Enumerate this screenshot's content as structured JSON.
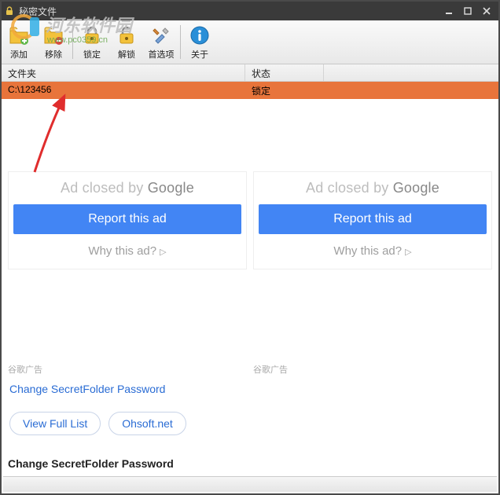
{
  "window": {
    "title": "秘密文件",
    "minimize": "—",
    "maximize": "□",
    "close": "×"
  },
  "toolbar": {
    "add": "添加",
    "remove": "移除",
    "lock": "锁定",
    "unlock": "解锁",
    "prefs": "首选项",
    "about": "关于"
  },
  "columns": {
    "folder": "文件夹",
    "status": "状态"
  },
  "rows": [
    {
      "path": "C:\\123456",
      "status": "锁定"
    }
  ],
  "watermark": {
    "text": "河东软件园",
    "url": "www.pc0359.cn"
  },
  "ad": {
    "closed_prefix": "Ad closed by ",
    "google": "Google",
    "report": "Report this ad",
    "why": "Why this ad?",
    "gads_label": "谷歌广告"
  },
  "links": {
    "change_pwd": "Change SecretFolder Password",
    "view_full": "View Full List",
    "ohsoft": "Ohsoft.net"
  },
  "heading": "Change SecretFolder Password"
}
